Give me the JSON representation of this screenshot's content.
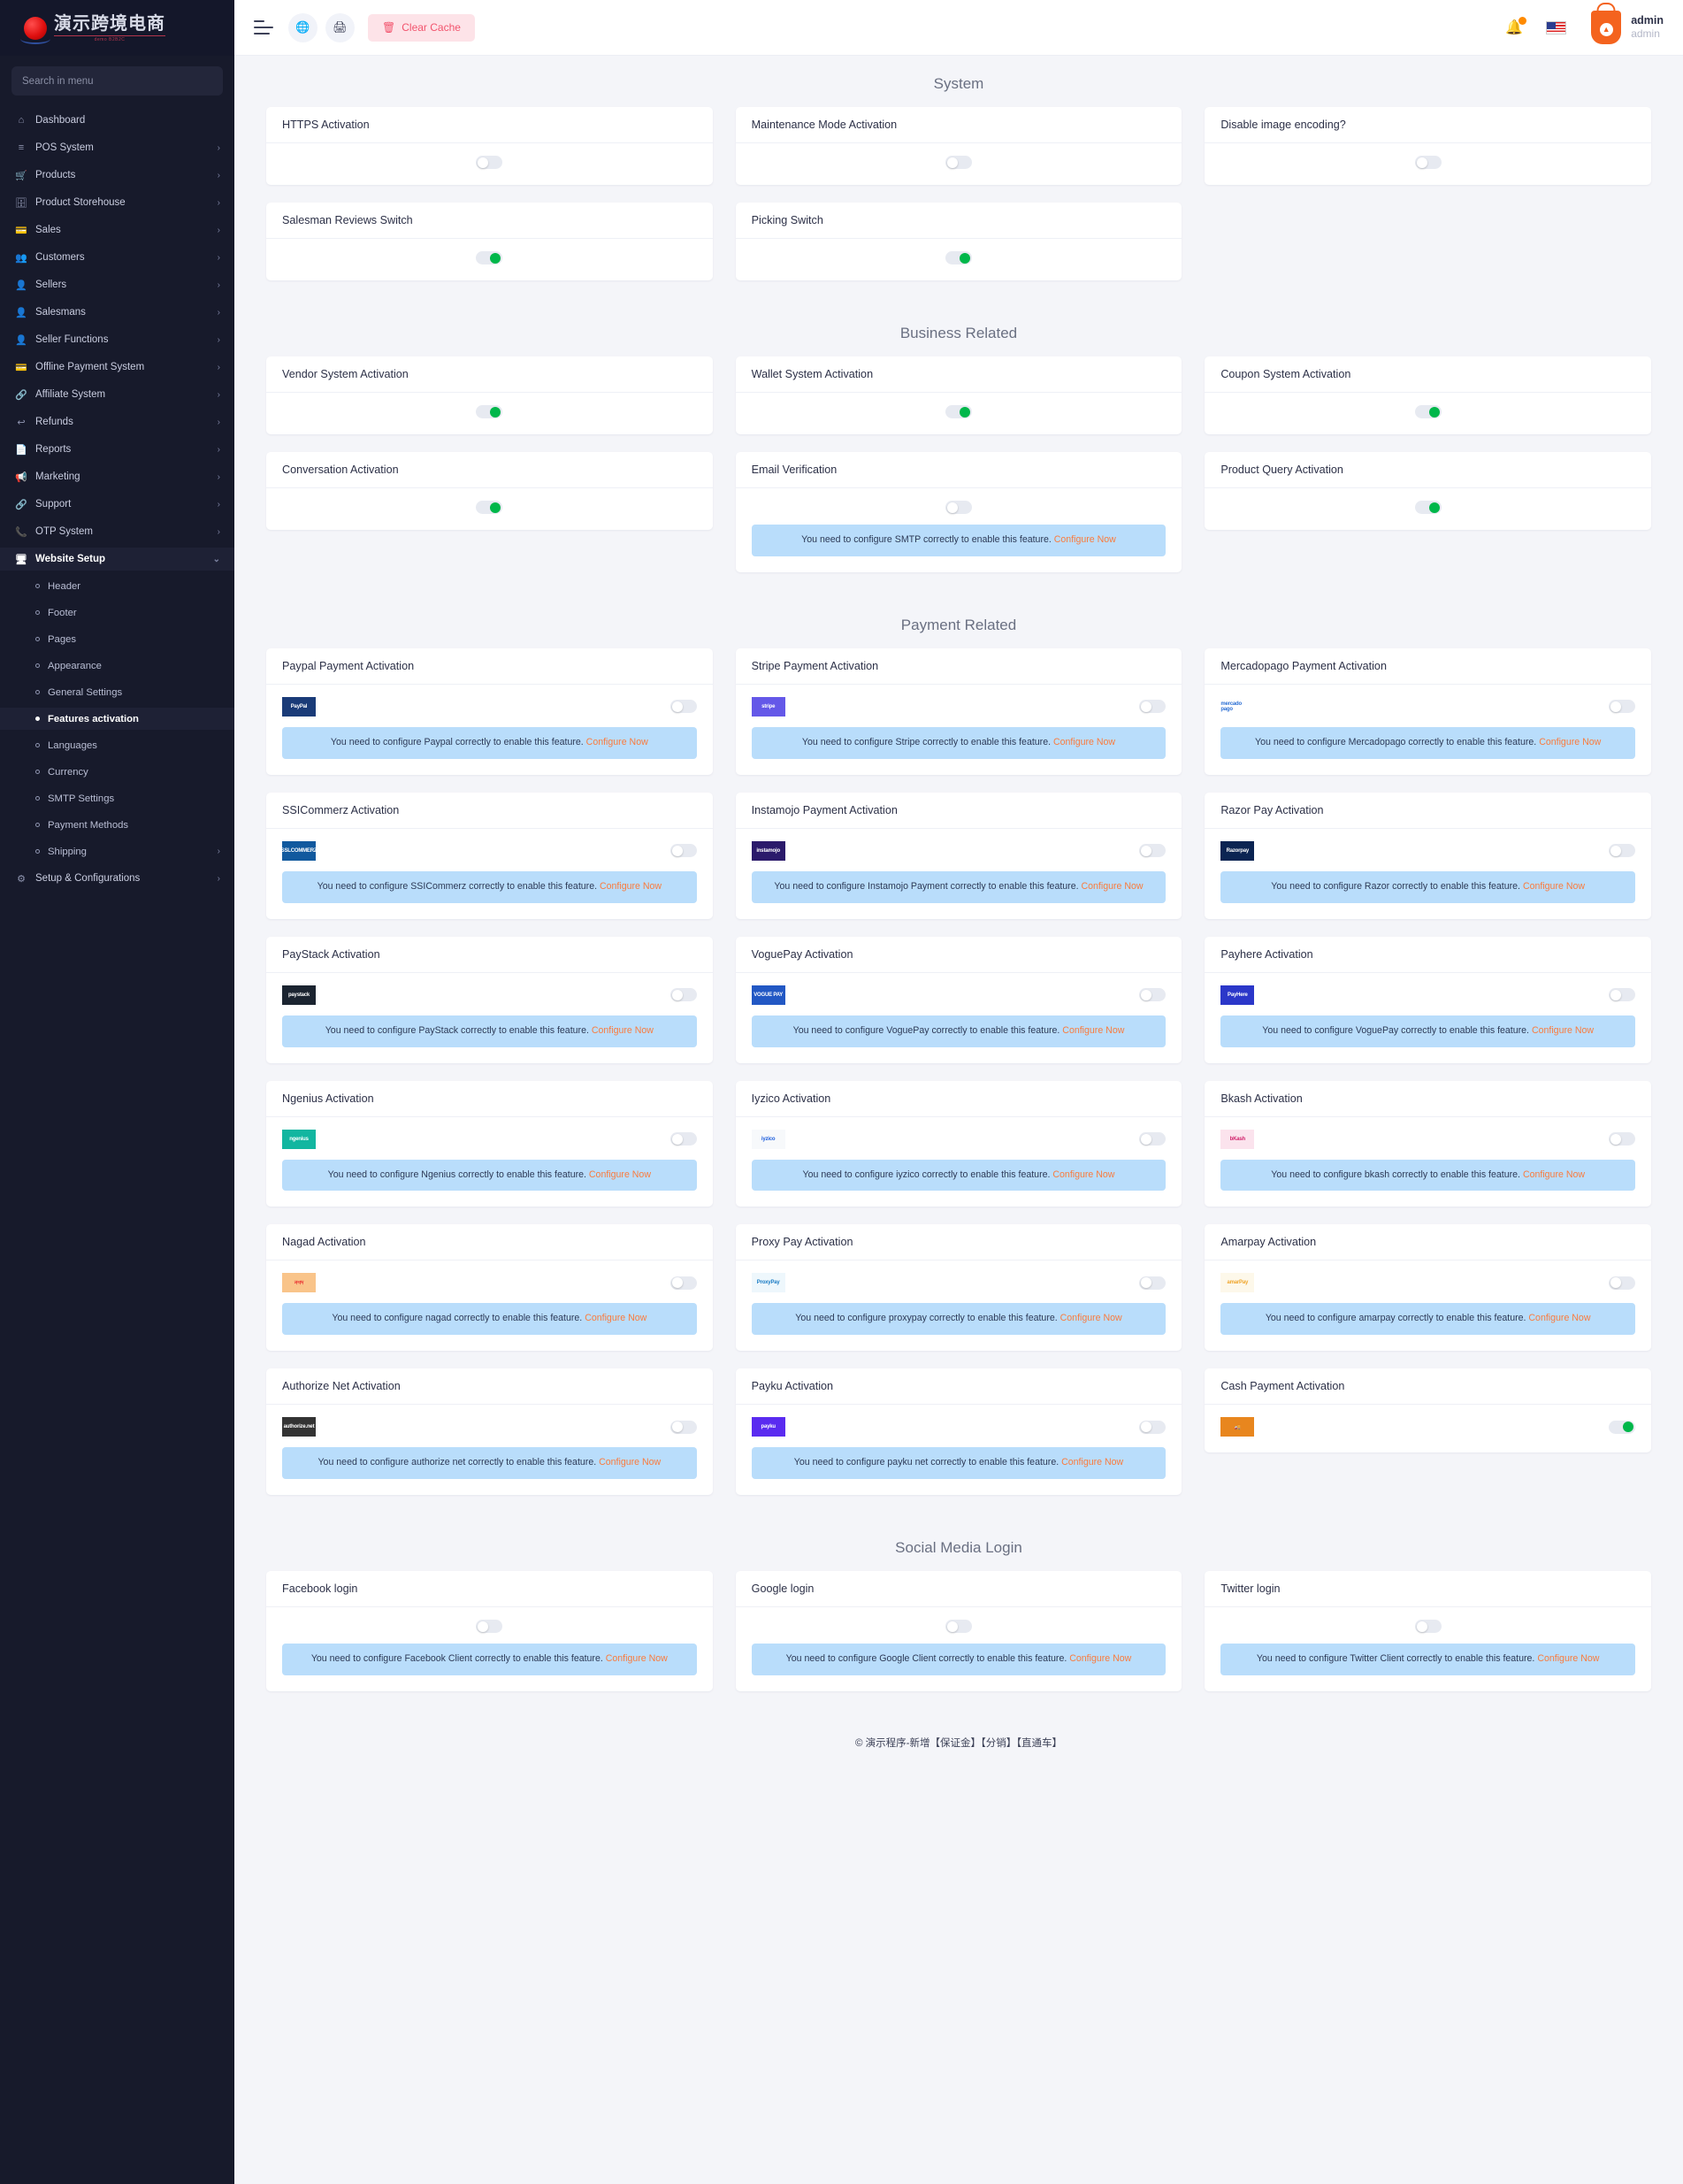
{
  "brand": {
    "name": "演示跨境电商",
    "sub": "demo B2B2C"
  },
  "sidebar": {
    "search_placeholder": "Search in menu",
    "items": [
      {
        "label": "Dashboard",
        "icon": "home-icon",
        "arrow": ""
      },
      {
        "label": "POS System",
        "icon": "list-icon",
        "arrow": "›"
      },
      {
        "label": "Products",
        "icon": "cart-icon",
        "arrow": "›"
      },
      {
        "label": "Product Storehouse",
        "icon": "archive-icon",
        "arrow": "›"
      },
      {
        "label": "Sales",
        "icon": "card-icon",
        "arrow": "›"
      },
      {
        "label": "Customers",
        "icon": "users-icon",
        "arrow": "›"
      },
      {
        "label": "Sellers",
        "icon": "user-icon",
        "arrow": "›"
      },
      {
        "label": "Salesmans",
        "icon": "user-icon",
        "arrow": "›"
      },
      {
        "label": "Seller Functions",
        "icon": "user-icon",
        "arrow": "›"
      },
      {
        "label": "Offline Payment System",
        "icon": "card-icon",
        "arrow": "›"
      },
      {
        "label": "Affiliate System",
        "icon": "link-icon",
        "arrow": "›"
      },
      {
        "label": "Refunds",
        "icon": "refund-icon",
        "arrow": "›"
      },
      {
        "label": "Reports",
        "icon": "document-icon",
        "arrow": "›"
      },
      {
        "label": "Marketing",
        "icon": "megaphone-icon",
        "arrow": "›"
      },
      {
        "label": "Support",
        "icon": "link-icon",
        "arrow": "›"
      },
      {
        "label": "OTP System",
        "icon": "phone-icon",
        "arrow": "›"
      },
      {
        "label": "Website Setup",
        "icon": "monitor-icon",
        "arrow": "⌄",
        "active": true
      }
    ],
    "submenu": [
      {
        "label": "Header",
        "arrow": ""
      },
      {
        "label": "Footer",
        "arrow": ""
      },
      {
        "label": "Pages",
        "arrow": ""
      },
      {
        "label": "Appearance",
        "arrow": ""
      },
      {
        "label": "General Settings",
        "arrow": ""
      },
      {
        "label": "Features activation",
        "arrow": "",
        "active": true
      },
      {
        "label": "Languages",
        "arrow": ""
      },
      {
        "label": "Currency",
        "arrow": ""
      },
      {
        "label": "SMTP Settings",
        "arrow": ""
      },
      {
        "label": "Payment Methods",
        "arrow": ""
      },
      {
        "label": "Shipping",
        "arrow": "›"
      }
    ],
    "after": [
      {
        "label": "Setup & Configurations",
        "icon": "gear-icon",
        "arrow": "›"
      }
    ]
  },
  "topbar": {
    "clear_cache_label": "Clear Cache",
    "globe_icon": "globe-icon",
    "print_icon": "printer-icon",
    "bell_icon": "bell-icon",
    "flag_icon": "us-flag-icon",
    "user_name": "admin",
    "user_role": "admin"
  },
  "sections": [
    {
      "title": "System",
      "cards": [
        {
          "title": "HTTPS Activation",
          "on": false
        },
        {
          "title": "Maintenance Mode Activation",
          "on": false
        },
        {
          "title": "Disable image encoding?",
          "on": false
        },
        {
          "title": "Salesman Reviews Switch",
          "on": true
        },
        {
          "title": "Picking Switch",
          "on": true
        }
      ]
    },
    {
      "title": "Business Related",
      "cards": [
        {
          "title": "Vendor System Activation",
          "on": true
        },
        {
          "title": "Wallet System Activation",
          "on": true
        },
        {
          "title": "Coupon System Activation",
          "on": true
        },
        {
          "title": "Conversation Activation",
          "on": true
        },
        {
          "title": "Email Verification",
          "on": false,
          "note": "You need to configure SMTP correctly to enable this feature. ",
          "note_link": "Configure Now"
        },
        {
          "title": "Product Query Activation",
          "on": true
        }
      ]
    },
    {
      "title": "Payment Related",
      "cards": [
        {
          "title": "Paypal Payment Activation",
          "on": false,
          "logo": {
            "name": "paypal-logo",
            "text": "PayPal",
            "bg": "#1a3b78",
            "fg": "#ffffff"
          },
          "note": "You need to configure Paypal correctly to enable this feature. ",
          "note_link": "Configure Now"
        },
        {
          "title": "Stripe Payment Activation",
          "on": false,
          "logo": {
            "name": "stripe-logo",
            "text": "stripe",
            "bg": "#6458e8",
            "fg": "#ffffff"
          },
          "note": "You need to configure Stripe correctly to enable this feature. ",
          "note_link": "Configure Now"
        },
        {
          "title": "Mercadopago Payment Activation",
          "on": false,
          "logo": {
            "name": "mercadopago-logo",
            "text": "mercado pago",
            "bg": "#ffffff",
            "fg": "#2b6fd4"
          },
          "note": "You need to configure Mercadopago correctly to enable this feature. ",
          "note_link": "Configure Now"
        },
        {
          "title": "SSICommerz Activation",
          "on": false,
          "logo": {
            "name": "sslcommerz-logo",
            "text": "SSLCOMMERZ",
            "bg": "#11599e",
            "fg": "#ffffff"
          },
          "note": "You need to configure SSICommerz correctly to enable this feature. ",
          "note_link": "Configure Now"
        },
        {
          "title": "Instamojo Payment Activation",
          "on": false,
          "logo": {
            "name": "instamojo-logo",
            "text": "instamojo",
            "bg": "#2b1a6b",
            "fg": "#ffffff"
          },
          "note": "You need to configure Instamojo Payment correctly to enable this feature. ",
          "note_link": "Configure Now"
        },
        {
          "title": "Razor Pay Activation",
          "on": false,
          "logo": {
            "name": "razorpay-logo",
            "text": "Razorpay",
            "bg": "#0b2452",
            "fg": "#ffffff"
          },
          "note": "You need to configure Razor correctly to enable this feature. ",
          "note_link": "Configure Now"
        },
        {
          "title": "PayStack Activation",
          "on": false,
          "logo": {
            "name": "paystack-logo",
            "text": "paystack",
            "bg": "#1b2430",
            "fg": "#ffffff"
          },
          "note": "You need to configure PayStack correctly to enable this feature. ",
          "note_link": "Configure Now"
        },
        {
          "title": "VoguePay Activation",
          "on": false,
          "logo": {
            "name": "voguepay-logo",
            "text": "VOGUE PAY",
            "bg": "#2258c4",
            "fg": "#ffffff"
          },
          "note": "You need to configure VoguePay correctly to enable this feature. ",
          "note_link": "Configure Now"
        },
        {
          "title": "Payhere Activation",
          "on": false,
          "logo": {
            "name": "payhere-logo",
            "text": "PayHere",
            "bg": "#2b37c9",
            "fg": "#ffffff"
          },
          "note": "You need to configure VoguePay correctly to enable this feature. ",
          "note_link": "Configure Now"
        },
        {
          "title": "Ngenius Activation",
          "on": false,
          "logo": {
            "name": "ngenius-logo",
            "text": "ngenius",
            "bg": "#12b6a0",
            "fg": "#ffffff"
          },
          "note": "You need to configure Ngenius correctly to enable this feature. ",
          "note_link": "Configure Now"
        },
        {
          "title": "Iyzico Activation",
          "on": false,
          "logo": {
            "name": "iyzico-logo",
            "text": "iyzico",
            "bg": "#f7f9fb",
            "fg": "#1c5ddd"
          },
          "note": "You need to configure iyzico correctly to enable this feature. ",
          "note_link": "Configure Now"
        },
        {
          "title": "Bkash Activation",
          "on": false,
          "logo": {
            "name": "bkash-logo",
            "text": "bKash",
            "bg": "#fbe3ed",
            "fg": "#d1216b"
          },
          "note": "You need to configure bkash correctly to enable this feature. ",
          "note_link": "Configure Now"
        },
        {
          "title": "Nagad Activation",
          "on": false,
          "logo": {
            "name": "nagad-logo",
            "text": "নগদ",
            "bg": "#f9c48a",
            "fg": "#e8252a"
          },
          "note": "You need to configure nagad correctly to enable this feature. ",
          "note_link": "Configure Now"
        },
        {
          "title": "Proxy Pay Activation",
          "on": false,
          "logo": {
            "name": "proxypay-logo",
            "text": "ProxyPay",
            "bg": "#eef7fc",
            "fg": "#1b7cc4"
          },
          "note": "You need to configure proxypay correctly to enable this feature. ",
          "note_link": "Configure Now"
        },
        {
          "title": "Amarpay Activation",
          "on": false,
          "logo": {
            "name": "amarpay-logo",
            "text": "amarPay",
            "bg": "#fdf8ea",
            "fg": "#f0a62c"
          },
          "note": "You need to configure amarpay correctly to enable this feature. ",
          "note_link": "Configure Now"
        },
        {
          "title": "Authorize Net Activation",
          "on": false,
          "logo": {
            "name": "authorizenet-logo",
            "text": "authorize.net",
            "bg": "#333333",
            "fg": "#ffffff"
          },
          "note": "You need to configure authorize net correctly to enable this feature. ",
          "note_link": "Configure Now"
        },
        {
          "title": "Payku Activation",
          "on": false,
          "logo": {
            "name": "payku-logo",
            "text": "payku",
            "bg": "#5a2bf0",
            "fg": "#ffffff"
          },
          "note": "You need to configure payku net correctly to enable this feature. ",
          "note_link": "Configure Now"
        },
        {
          "title": "Cash Payment Activation",
          "on": true,
          "logo": {
            "name": "cash-on-delivery-icon",
            "text": "🚚",
            "bg": "#e8861e",
            "fg": "#ffffff"
          }
        }
      ]
    },
    {
      "title": "Social Media Login",
      "cards": [
        {
          "title": "Facebook login",
          "on": false,
          "note": "You need to configure Facebook Client correctly to enable this feature. ",
          "note_link": "Configure Now"
        },
        {
          "title": "Google login",
          "on": false,
          "note": "You need to configure Google Client correctly to enable this feature. ",
          "note_link": "Configure Now"
        },
        {
          "title": "Twitter login",
          "on": false,
          "note": "You need to configure Twitter Client correctly to enable this feature. ",
          "note_link": "Configure Now"
        }
      ]
    }
  ],
  "footer": {
    "text": "© 演示程序-新增【保证金】【分销】【直通车】"
  }
}
